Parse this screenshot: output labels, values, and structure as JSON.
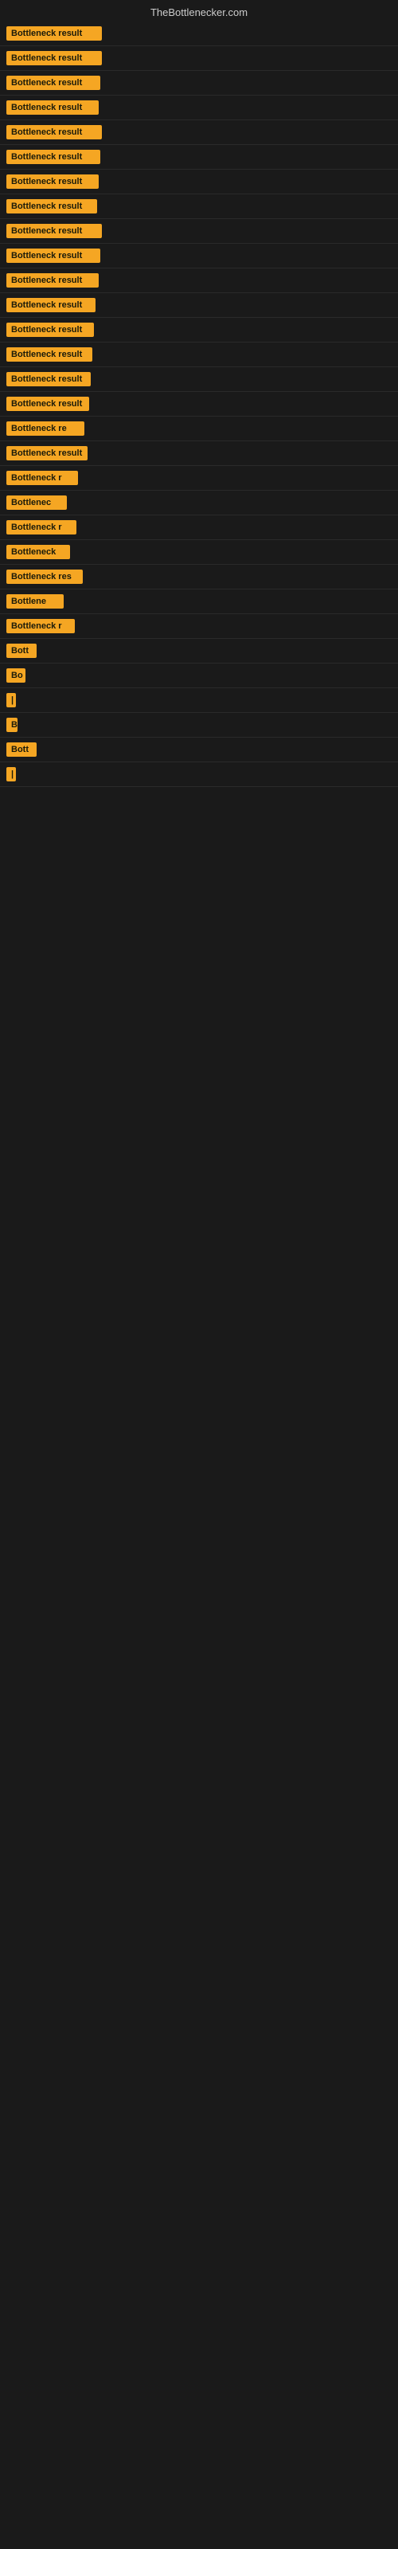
{
  "header": {
    "title": "TheBottlenecker.com"
  },
  "rows": [
    {
      "label": "Bottleneck result",
      "width": 120
    },
    {
      "label": "Bottleneck result",
      "width": 120
    },
    {
      "label": "Bottleneck result",
      "width": 118
    },
    {
      "label": "Bottleneck result",
      "width": 116
    },
    {
      "label": "Bottleneck result",
      "width": 120
    },
    {
      "label": "Bottleneck result",
      "width": 118
    },
    {
      "label": "Bottleneck result",
      "width": 116
    },
    {
      "label": "Bottleneck result",
      "width": 114
    },
    {
      "label": "Bottleneck result",
      "width": 120
    },
    {
      "label": "Bottleneck result",
      "width": 118
    },
    {
      "label": "Bottleneck result",
      "width": 116
    },
    {
      "label": "Bottleneck result",
      "width": 112
    },
    {
      "label": "Bottleneck result",
      "width": 110
    },
    {
      "label": "Bottleneck result",
      "width": 108
    },
    {
      "label": "Bottleneck result",
      "width": 106
    },
    {
      "label": "Bottleneck result",
      "width": 104
    },
    {
      "label": "Bottleneck re",
      "width": 98
    },
    {
      "label": "Bottleneck result",
      "width": 102
    },
    {
      "label": "Bottleneck r",
      "width": 90
    },
    {
      "label": "Bottlenec",
      "width": 76
    },
    {
      "label": "Bottleneck r",
      "width": 88
    },
    {
      "label": "Bottleneck",
      "width": 80
    },
    {
      "label": "Bottleneck res",
      "width": 96
    },
    {
      "label": "Bottlene",
      "width": 72
    },
    {
      "label": "Bottleneck r",
      "width": 86
    },
    {
      "label": "Bott",
      "width": 38
    },
    {
      "label": "Bo",
      "width": 24
    },
    {
      "label": "|",
      "width": 8
    },
    {
      "label": "B",
      "width": 14
    },
    {
      "label": "Bott",
      "width": 38
    },
    {
      "label": "|",
      "width": 8
    }
  ],
  "accent_color": "#f5a623",
  "bg_color": "#1a1a1a"
}
